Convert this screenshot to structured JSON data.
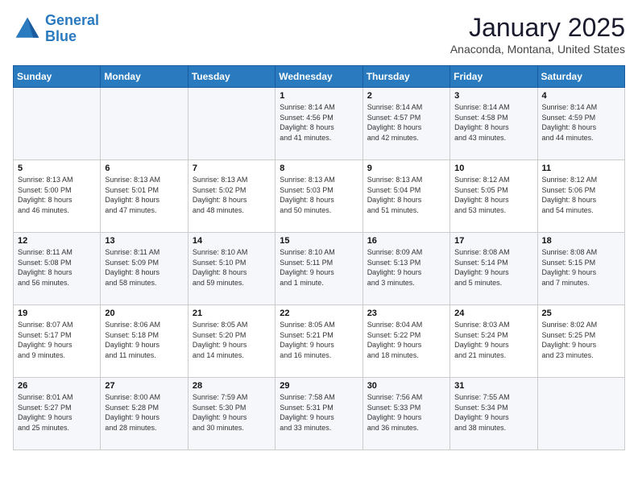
{
  "header": {
    "logo_line1": "General",
    "logo_line2": "Blue",
    "month": "January 2025",
    "location": "Anaconda, Montana, United States"
  },
  "weekdays": [
    "Sunday",
    "Monday",
    "Tuesday",
    "Wednesday",
    "Thursday",
    "Friday",
    "Saturday"
  ],
  "weeks": [
    [
      {
        "day": "",
        "info": ""
      },
      {
        "day": "",
        "info": ""
      },
      {
        "day": "",
        "info": ""
      },
      {
        "day": "1",
        "info": "Sunrise: 8:14 AM\nSunset: 4:56 PM\nDaylight: 8 hours\nand 41 minutes."
      },
      {
        "day": "2",
        "info": "Sunrise: 8:14 AM\nSunset: 4:57 PM\nDaylight: 8 hours\nand 42 minutes."
      },
      {
        "day": "3",
        "info": "Sunrise: 8:14 AM\nSunset: 4:58 PM\nDaylight: 8 hours\nand 43 minutes."
      },
      {
        "day": "4",
        "info": "Sunrise: 8:14 AM\nSunset: 4:59 PM\nDaylight: 8 hours\nand 44 minutes."
      }
    ],
    [
      {
        "day": "5",
        "info": "Sunrise: 8:13 AM\nSunset: 5:00 PM\nDaylight: 8 hours\nand 46 minutes."
      },
      {
        "day": "6",
        "info": "Sunrise: 8:13 AM\nSunset: 5:01 PM\nDaylight: 8 hours\nand 47 minutes."
      },
      {
        "day": "7",
        "info": "Sunrise: 8:13 AM\nSunset: 5:02 PM\nDaylight: 8 hours\nand 48 minutes."
      },
      {
        "day": "8",
        "info": "Sunrise: 8:13 AM\nSunset: 5:03 PM\nDaylight: 8 hours\nand 50 minutes."
      },
      {
        "day": "9",
        "info": "Sunrise: 8:13 AM\nSunset: 5:04 PM\nDaylight: 8 hours\nand 51 minutes."
      },
      {
        "day": "10",
        "info": "Sunrise: 8:12 AM\nSunset: 5:05 PM\nDaylight: 8 hours\nand 53 minutes."
      },
      {
        "day": "11",
        "info": "Sunrise: 8:12 AM\nSunset: 5:06 PM\nDaylight: 8 hours\nand 54 minutes."
      }
    ],
    [
      {
        "day": "12",
        "info": "Sunrise: 8:11 AM\nSunset: 5:08 PM\nDaylight: 8 hours\nand 56 minutes."
      },
      {
        "day": "13",
        "info": "Sunrise: 8:11 AM\nSunset: 5:09 PM\nDaylight: 8 hours\nand 58 minutes."
      },
      {
        "day": "14",
        "info": "Sunrise: 8:10 AM\nSunset: 5:10 PM\nDaylight: 8 hours\nand 59 minutes."
      },
      {
        "day": "15",
        "info": "Sunrise: 8:10 AM\nSunset: 5:11 PM\nDaylight: 9 hours\nand 1 minute."
      },
      {
        "day": "16",
        "info": "Sunrise: 8:09 AM\nSunset: 5:13 PM\nDaylight: 9 hours\nand 3 minutes."
      },
      {
        "day": "17",
        "info": "Sunrise: 8:08 AM\nSunset: 5:14 PM\nDaylight: 9 hours\nand 5 minutes."
      },
      {
        "day": "18",
        "info": "Sunrise: 8:08 AM\nSunset: 5:15 PM\nDaylight: 9 hours\nand 7 minutes."
      }
    ],
    [
      {
        "day": "19",
        "info": "Sunrise: 8:07 AM\nSunset: 5:17 PM\nDaylight: 9 hours\nand 9 minutes."
      },
      {
        "day": "20",
        "info": "Sunrise: 8:06 AM\nSunset: 5:18 PM\nDaylight: 9 hours\nand 11 minutes."
      },
      {
        "day": "21",
        "info": "Sunrise: 8:05 AM\nSunset: 5:20 PM\nDaylight: 9 hours\nand 14 minutes."
      },
      {
        "day": "22",
        "info": "Sunrise: 8:05 AM\nSunset: 5:21 PM\nDaylight: 9 hours\nand 16 minutes."
      },
      {
        "day": "23",
        "info": "Sunrise: 8:04 AM\nSunset: 5:22 PM\nDaylight: 9 hours\nand 18 minutes."
      },
      {
        "day": "24",
        "info": "Sunrise: 8:03 AM\nSunset: 5:24 PM\nDaylight: 9 hours\nand 21 minutes."
      },
      {
        "day": "25",
        "info": "Sunrise: 8:02 AM\nSunset: 5:25 PM\nDaylight: 9 hours\nand 23 minutes."
      }
    ],
    [
      {
        "day": "26",
        "info": "Sunrise: 8:01 AM\nSunset: 5:27 PM\nDaylight: 9 hours\nand 25 minutes."
      },
      {
        "day": "27",
        "info": "Sunrise: 8:00 AM\nSunset: 5:28 PM\nDaylight: 9 hours\nand 28 minutes."
      },
      {
        "day": "28",
        "info": "Sunrise: 7:59 AM\nSunset: 5:30 PM\nDaylight: 9 hours\nand 30 minutes."
      },
      {
        "day": "29",
        "info": "Sunrise: 7:58 AM\nSunset: 5:31 PM\nDaylight: 9 hours\nand 33 minutes."
      },
      {
        "day": "30",
        "info": "Sunrise: 7:56 AM\nSunset: 5:33 PM\nDaylight: 9 hours\nand 36 minutes."
      },
      {
        "day": "31",
        "info": "Sunrise: 7:55 AM\nSunset: 5:34 PM\nDaylight: 9 hours\nand 38 minutes."
      },
      {
        "day": "",
        "info": ""
      }
    ]
  ]
}
